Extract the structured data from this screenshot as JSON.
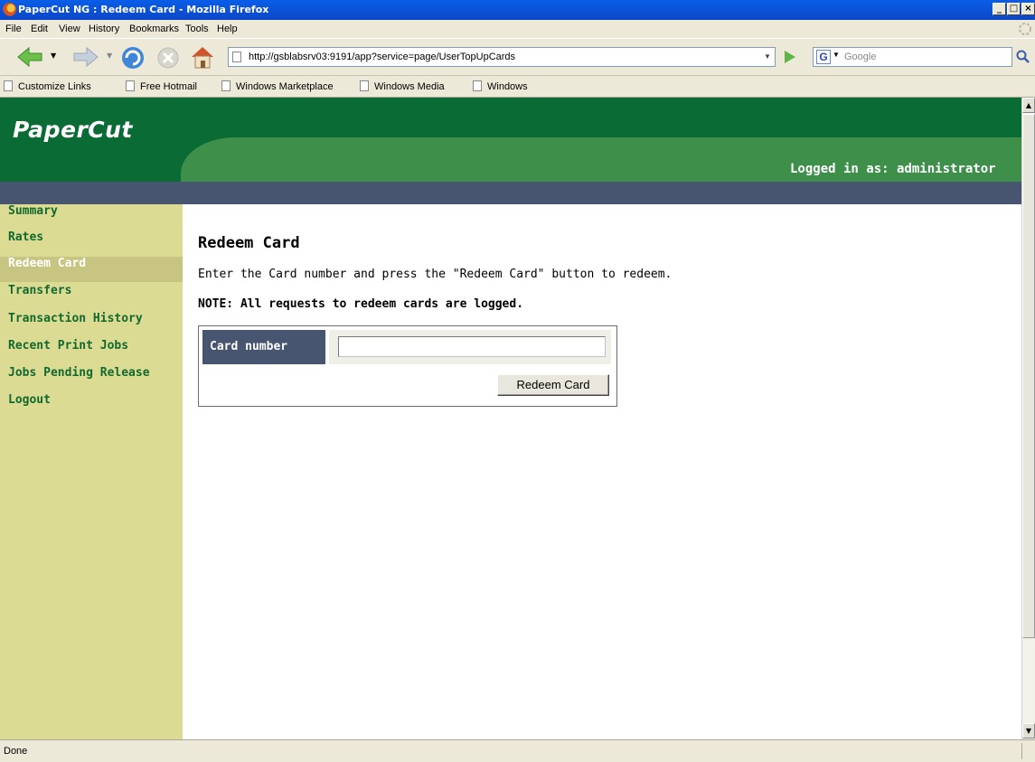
{
  "window": {
    "title": "PaperCut NG : Redeem Card - Mozilla Firefox",
    "controls": [
      "minimize",
      "maximize",
      "close"
    ]
  },
  "menu": {
    "items": [
      "File",
      "Edit",
      "View",
      "History",
      "Bookmarks",
      "Tools",
      "Help"
    ]
  },
  "toolbar": {
    "url": "http://gsblabsrv03:9191/app?service=page/UserTopUpCards",
    "search_placeholder": "Google",
    "search_engine_letter": "G",
    "icons": [
      "back-icon",
      "forward-icon",
      "reload-icon",
      "stop-icon",
      "home-icon",
      "go-icon",
      "search-icon"
    ]
  },
  "bookmarks": {
    "items": [
      "Customize Links",
      "Free Hotmail",
      "Windows Marketplace",
      "Windows Media",
      "Windows"
    ]
  },
  "app": {
    "logo": "PaperCut",
    "logged_in": "Logged in as:  administrator",
    "brand_colors": {
      "dark_green": "#0b6b35",
      "light_green": "#3d8f4a",
      "slate": "#485570",
      "sidebar": "#dcdb94"
    }
  },
  "sidebar": {
    "items": [
      {
        "label": "Summary",
        "active": false
      },
      {
        "label": "Rates",
        "active": false
      },
      {
        "label": "Redeem Card",
        "active": true
      },
      {
        "label": "Transfers",
        "active": false
      },
      {
        "label": "Transaction History",
        "active": false
      },
      {
        "label": "Recent Print Jobs",
        "active": false
      },
      {
        "label": "Jobs Pending Release",
        "active": false
      },
      {
        "label": "Logout",
        "active": false
      }
    ]
  },
  "content": {
    "title": "Redeem Card",
    "instructions": "Enter the Card number and press the \"Redeem Card\" button to redeem.",
    "note": "NOTE: All requests to redeem cards are logged.",
    "form": {
      "card_label": "Card number",
      "card_value": "",
      "submit_label": "Redeem Card"
    }
  },
  "status": {
    "text": "Done"
  }
}
